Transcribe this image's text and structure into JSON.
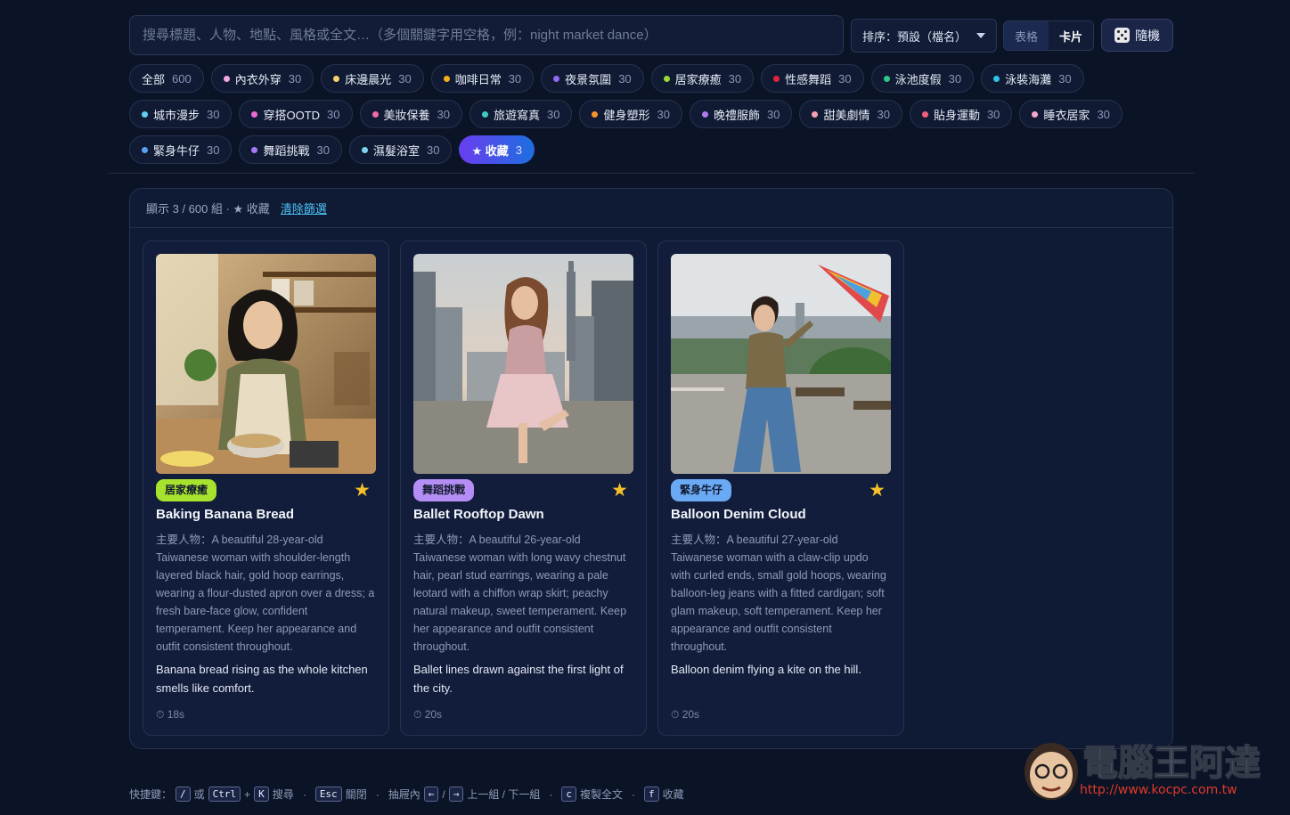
{
  "search": {
    "placeholder": "搜尋標題、人物、地點、風格或全文…（多個關鍵字用空格，例：night market dance）"
  },
  "sort": {
    "label": "排序：預設（檔名）"
  },
  "view": {
    "table": "表格",
    "card": "卡片",
    "active": "card"
  },
  "random_label": "隨機",
  "chips": [
    [
      {
        "label": "全部",
        "count": "600",
        "dot": ""
      },
      {
        "label": "內衣外穿",
        "count": "30",
        "dot": "#f4a7e0"
      },
      {
        "label": "床邊晨光",
        "count": "30",
        "dot": "#f5d36b"
      },
      {
        "label": "咖啡日常",
        "count": "30",
        "dot": "#f2b01e"
      },
      {
        "label": "夜景氛圍",
        "count": "30",
        "dot": "#8e6cf2"
      },
      {
        "label": "居家療癒",
        "count": "30",
        "dot": "#9ad83a"
      },
      {
        "label": "性感舞蹈",
        "count": "30",
        "dot": "#e0243a"
      },
      {
        "label": "泳池度假",
        "count": "30",
        "dot": "#2ec98a"
      },
      {
        "label": "泳裝海灘",
        "count": "30",
        "dot": "#2ec4e8"
      }
    ],
    [
      {
        "label": "城市漫步",
        "count": "30",
        "dot": "#5fd0f0"
      },
      {
        "label": "穿搭OOTD",
        "count": "30",
        "dot": "#e86ad4"
      },
      {
        "label": "美妝保養",
        "count": "30",
        "dot": "#f06aa8"
      },
      {
        "label": "旅遊寫真",
        "count": "30",
        "dot": "#3fc9c0"
      },
      {
        "label": "健身塑形",
        "count": "30",
        "dot": "#f5952a"
      },
      {
        "label": "晚禮服飾",
        "count": "30",
        "dot": "#b07af0"
      },
      {
        "label": "甜美劇情",
        "count": "30",
        "dot": "#f6a0b6"
      },
      {
        "label": "貼身運動",
        "count": "30",
        "dot": "#f0607a"
      },
      {
        "label": "睡衣居家",
        "count": "30",
        "dot": "#f1a8cc"
      }
    ],
    [
      {
        "label": "緊身牛仔",
        "count": "30",
        "dot": "#5aa0f0"
      },
      {
        "label": "舞蹈挑戰",
        "count": "30",
        "dot": "#a47af5"
      },
      {
        "label": "濕髮浴室",
        "count": "30",
        "dot": "#7fd3f0"
      },
      {
        "label": "★ 收藏",
        "count": "3",
        "dot": "",
        "active": true
      }
    ]
  ],
  "panel": {
    "status": "顯示 3 / 600 組 · ★ 收藏",
    "clear": "清除篩選"
  },
  "cards": [
    {
      "tag": "居家療癒",
      "tag_color": "#a6e22e",
      "starred": "★",
      "title": "Baking Banana Bread",
      "desc": "主要人物：A beautiful 28-year-old Taiwanese woman with shoulder-length layered black hair, gold hoop earrings, wearing a flour-dusted apron over a dress; a fresh bare-face glow, confident temperament. Keep her appearance and outfit consistent throughout.",
      "caption": "Banana bread rising as the whole kitchen smells like comfort.",
      "time": "⏱ 18s"
    },
    {
      "tag": "舞蹈挑戰",
      "tag_color": "#b48ef5",
      "starred": "★",
      "title": "Ballet Rooftop Dawn",
      "desc": "主要人物：A beautiful 26-year-old Taiwanese woman with long wavy chestnut hair, pearl stud earrings, wearing a pale leotard with a chiffon wrap skirt; peachy natural makeup, sweet temperament. Keep her appearance and outfit consistent throughout.",
      "caption": "Ballet lines drawn against the first light of the city.",
      "time": "⏱ 20s"
    },
    {
      "tag": "緊身牛仔",
      "tag_color": "#6aaaf5",
      "starred": "★",
      "title": "Balloon Denim Cloud",
      "desc": "主要人物：A beautiful 27-year-old Taiwanese woman with a claw-clip updo with curled ends, small gold hoops, wearing balloon-leg jeans with a fitted cardigan; soft glam makeup, soft temperament. Keep her appearance and outfit consistent throughout.",
      "caption": "Balloon denim flying a kite on the hill.",
      "time": "⏱ 20s"
    }
  ],
  "footer": {
    "prefix": "快捷鍵：",
    "k_slash": "/",
    "or": "或",
    "k_ctrl": "Ctrl",
    "plus": "+",
    "k_k": "K",
    "search": "搜尋",
    "k_esc": "Esc",
    "close": "關閉",
    "drawer": "抽屜內",
    "k_left": "←",
    "slash": "/",
    "k_right": "→",
    "prevnext": "上一組 / 下一組",
    "k_c": "c",
    "copy": "複製全文",
    "k_f": "f",
    "fav": "收藏",
    "dot": "·"
  },
  "watermark": {
    "title": "電腦王阿達",
    "url": "http://www.kocpc.com.tw"
  }
}
